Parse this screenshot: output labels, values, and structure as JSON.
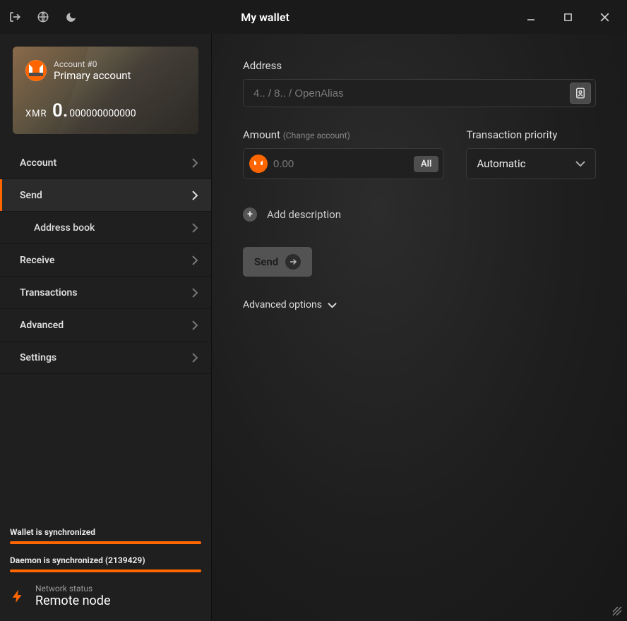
{
  "window": {
    "title": "My wallet"
  },
  "account": {
    "subtitle": "Account #0",
    "name": "Primary account",
    "currency": "XMR",
    "balance_int": "0.",
    "balance_frac": "000000000000"
  },
  "nav": {
    "account": "Account",
    "send": "Send",
    "address_book": "Address book",
    "receive": "Receive",
    "transactions": "Transactions",
    "advanced": "Advanced",
    "settings": "Settings"
  },
  "sync": {
    "wallet_label": "Wallet is synchronized",
    "daemon_label": "Daemon is synchronized (2139429)"
  },
  "network": {
    "status_label": "Network status",
    "value": "Remote node"
  },
  "send_form": {
    "address_label": "Address",
    "address_placeholder": "4.. / 8.. / OpenAlias",
    "amount_label": "Amount",
    "amount_hint": "(Change account)",
    "amount_placeholder": "0.00",
    "all_button": "All",
    "priority_label": "Transaction priority",
    "priority_value": "Automatic",
    "add_description": "Add description",
    "send_button": "Send",
    "advanced_options": "Advanced options"
  }
}
